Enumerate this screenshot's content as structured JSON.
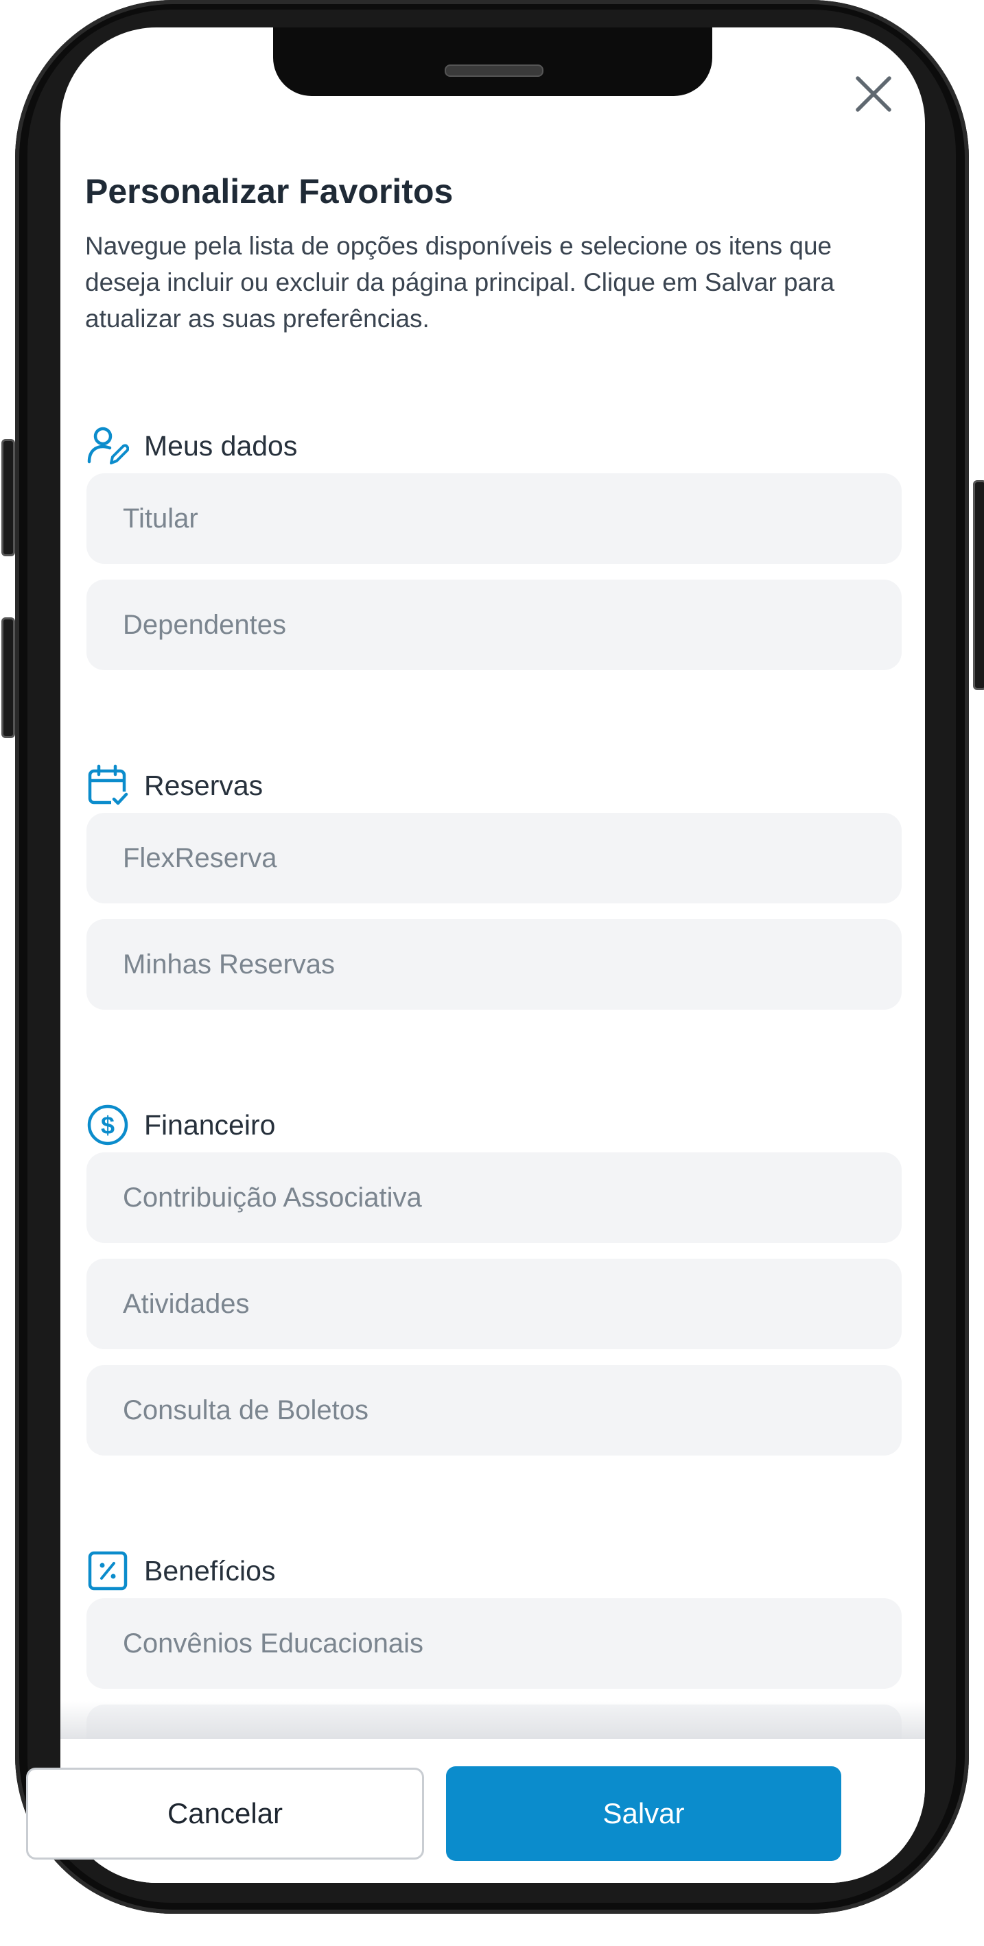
{
  "modal": {
    "title": "Personalizar Favoritos",
    "description": "Navegue pela lista de opções disponíveis e selecione os itens que deseja incluir ou excluir da página principal. Clique em Salvar para atualizar as suas preferências.",
    "close_icon": "close-icon"
  },
  "sections": [
    {
      "label": "Meus dados",
      "icon": "user-edit-icon",
      "items": [
        "Titular",
        "Dependentes"
      ]
    },
    {
      "label": "Reservas",
      "icon": "calendar-check-icon",
      "items": [
        "FlexReserva",
        "Minhas Reservas"
      ]
    },
    {
      "label": "Financeiro",
      "icon": "dollar-circle-icon",
      "items": [
        "Contribuição Associativa",
        "Atividades",
        "Consulta de Boletos"
      ]
    },
    {
      "label": "Benefícios",
      "icon": "percent-badge-icon",
      "items": [
        "Convênios Educacionais"
      ]
    }
  ],
  "footer": {
    "cancel_label": "Cancelar",
    "save_label": "Salvar"
  },
  "colors": {
    "accent": "#0b8ccc",
    "item_background": "#f3f4f6",
    "title": "#1f2a36"
  }
}
